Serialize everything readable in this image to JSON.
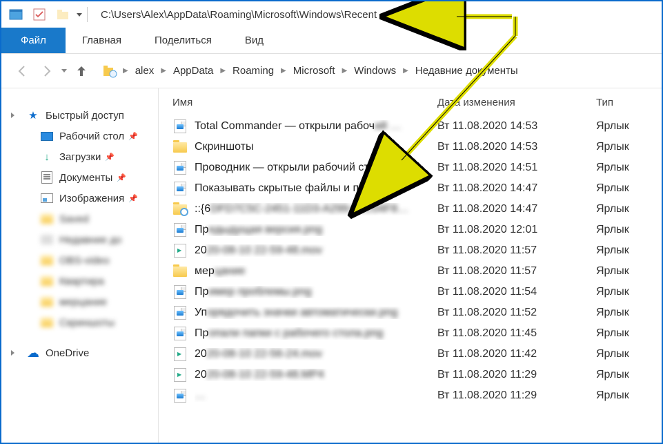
{
  "titlebar": {
    "path": "C:\\Users\\Alex\\AppData\\Roaming\\Microsoft\\Windows\\Recent"
  },
  "ribbon": {
    "file": "Файл",
    "home": "Главная",
    "share": "Поделиться",
    "view": "Вид"
  },
  "breadcrumb": [
    "alex",
    "AppData",
    "Roaming",
    "Microsoft",
    "Windows",
    "Недавние документы"
  ],
  "sidebar": {
    "quick_access": "Быстрый доступ",
    "desktop": "Рабочий стол",
    "downloads": "Загрузки",
    "documents": "Документы",
    "images": "Изображения",
    "blurred": [
      "Saved",
      "Недавние до",
      "OBS-video",
      "Квартира",
      "мерцание",
      "Скриншоты"
    ],
    "onedrive": "OneDrive"
  },
  "columns": {
    "name": "Имя",
    "date": "Дата изменения",
    "type": "Тип"
  },
  "type_label": "Ярлык",
  "rows": [
    {
      "icon": "shortcut",
      "name_pre": "Total Commander — открыли рабоч",
      "name_blur": "ий …",
      "date": "Вт 11.08.2020 14:53"
    },
    {
      "icon": "folder",
      "name_pre": "Скриншоты",
      "name_blur": "",
      "date": "Вт 11.08.2020 14:53"
    },
    {
      "icon": "shortcut",
      "name_pre": "Проводник — открыли рабочий стол.р…",
      "name_blur": "",
      "date": "Вт 11.08.2020 14:51"
    },
    {
      "icon": "shortcut",
      "name_pre": "Показывать скрытые файлы и папки.png",
      "name_blur": "",
      "date": "Вт 11.08.2020 14:47"
    },
    {
      "icon": "foldersearch",
      "name_pre": "::{6",
      "name_blur": "DFD7C5C-2451-11D3-A299-00C04F8…",
      "date": "Вт 11.08.2020 14:47"
    },
    {
      "icon": "shortcut",
      "name_pre": "Пр",
      "name_blur": "едыдущая версия.png",
      "date": "Вт 11.08.2020 12:01"
    },
    {
      "icon": "mov",
      "name_pre": "20",
      "name_blur": "20-08-10 22-59-48.mov",
      "date": "Вт 11.08.2020 11:57"
    },
    {
      "icon": "folder",
      "name_pre": "мер",
      "name_blur": "цание",
      "date": "Вт 11.08.2020 11:57"
    },
    {
      "icon": "shortcut",
      "name_pre": "Пр",
      "name_blur": "имер проблемы.png",
      "date": "Вт 11.08.2020 11:54"
    },
    {
      "icon": "shortcut",
      "name_pre": "Уп",
      "name_blur": "орядочить значки автоматически.png",
      "date": "Вт 11.08.2020 11:52"
    },
    {
      "icon": "shortcut",
      "name_pre": "Пр",
      "name_blur": "опали папки с рабочего стола.png",
      "date": "Вт 11.08.2020 11:45"
    },
    {
      "icon": "mov",
      "name_pre": "20",
      "name_blur": "20-08-10 22-56-24.mov",
      "date": "Вт 11.08.2020 11:42"
    },
    {
      "icon": "mov",
      "name_pre": "20",
      "name_blur": "20-08-10 22-59-48.MP4",
      "date": "Вт 11.08.2020 11:29"
    },
    {
      "icon": "shortcut",
      "name_pre": "",
      "name_blur": "…",
      "date": "Вт 11.08.2020 11:29"
    }
  ]
}
